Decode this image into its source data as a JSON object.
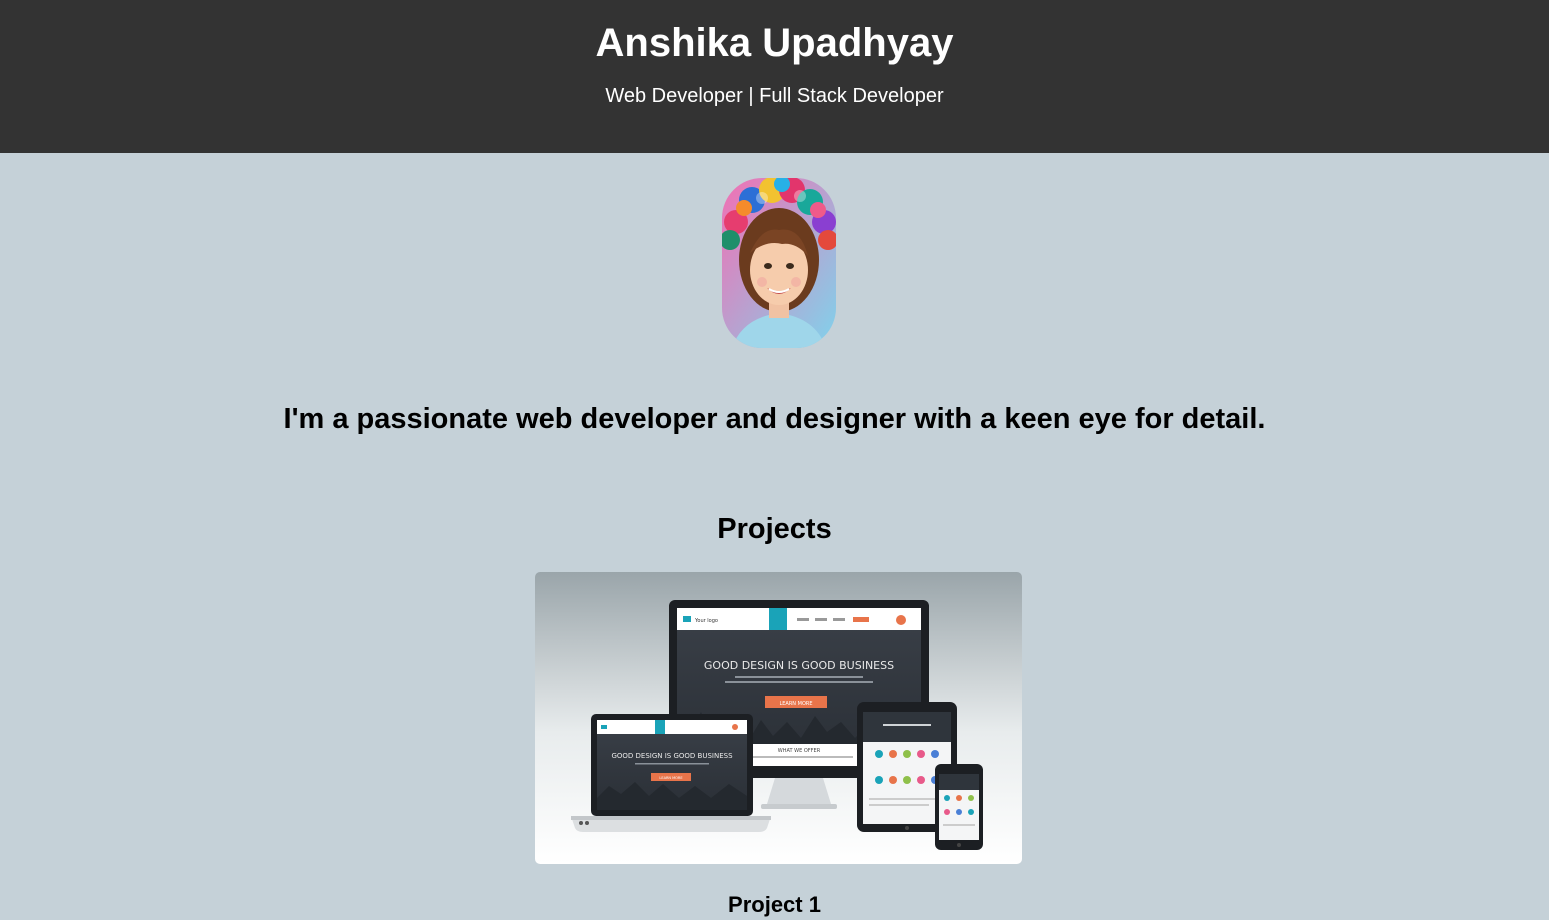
{
  "header": {
    "name": "Anshika Upadhyay",
    "subtitle": "Web Developer | Full Stack Developer"
  },
  "profile": {
    "avatar_icon": "profile-photo"
  },
  "intro": {
    "text": "I'm a passionate web developer and designer with a keen eye for detail."
  },
  "projects": {
    "heading": "Projects",
    "items": [
      {
        "title": "Project 1",
        "mockup": {
          "desktop_headline": "GOOD DESIGN IS GOOD BUSINESS",
          "laptop_headline": "GOOD DESIGN IS GOOD BUSINESS",
          "desktop_button": "LEARN MORE",
          "laptop_button": "LEARN MORE",
          "desktop_section": "WHAT WE OFFER",
          "logo_text": "Your logo"
        }
      }
    ]
  },
  "colors": {
    "header_bg": "#333333",
    "page_bg": "#c5d1d8",
    "mock_accent": "#e8744a",
    "mock_nav_accent": "#1aa3b8"
  }
}
